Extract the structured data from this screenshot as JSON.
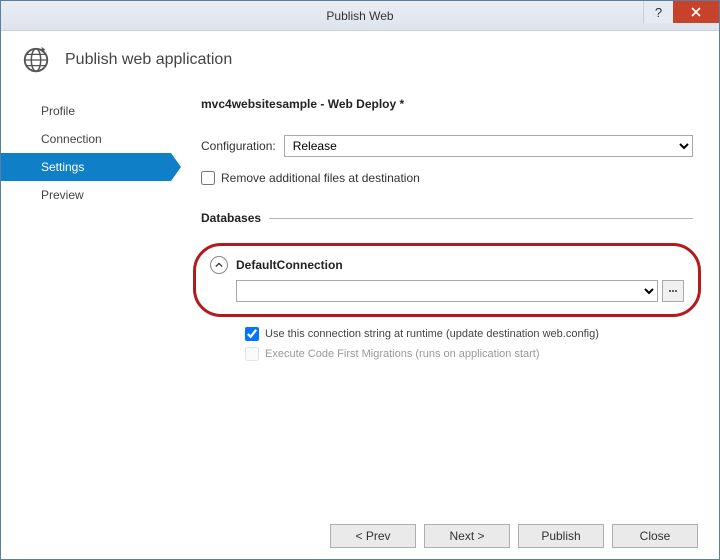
{
  "window": {
    "title": "Publish Web"
  },
  "header": {
    "title": "Publish web application"
  },
  "sidebar": {
    "items": [
      {
        "label": "Profile"
      },
      {
        "label": "Connection"
      },
      {
        "label": "Settings"
      },
      {
        "label": "Preview"
      }
    ]
  },
  "main": {
    "page_title": "mvc4websitesample - Web Deploy *",
    "config_label": "Configuration:",
    "config_value": "Release",
    "remove_files_label": "Remove additional files at destination",
    "databases_label": "Databases",
    "connection_name": "DefaultConnection",
    "use_conn_label": "Use this connection string at runtime (update destination web.config)",
    "execute_cf_label": "Execute Code First Migrations (runs on application start)"
  },
  "footer": {
    "prev": "< Prev",
    "next": "Next >",
    "publish": "Publish",
    "close": "Close"
  }
}
